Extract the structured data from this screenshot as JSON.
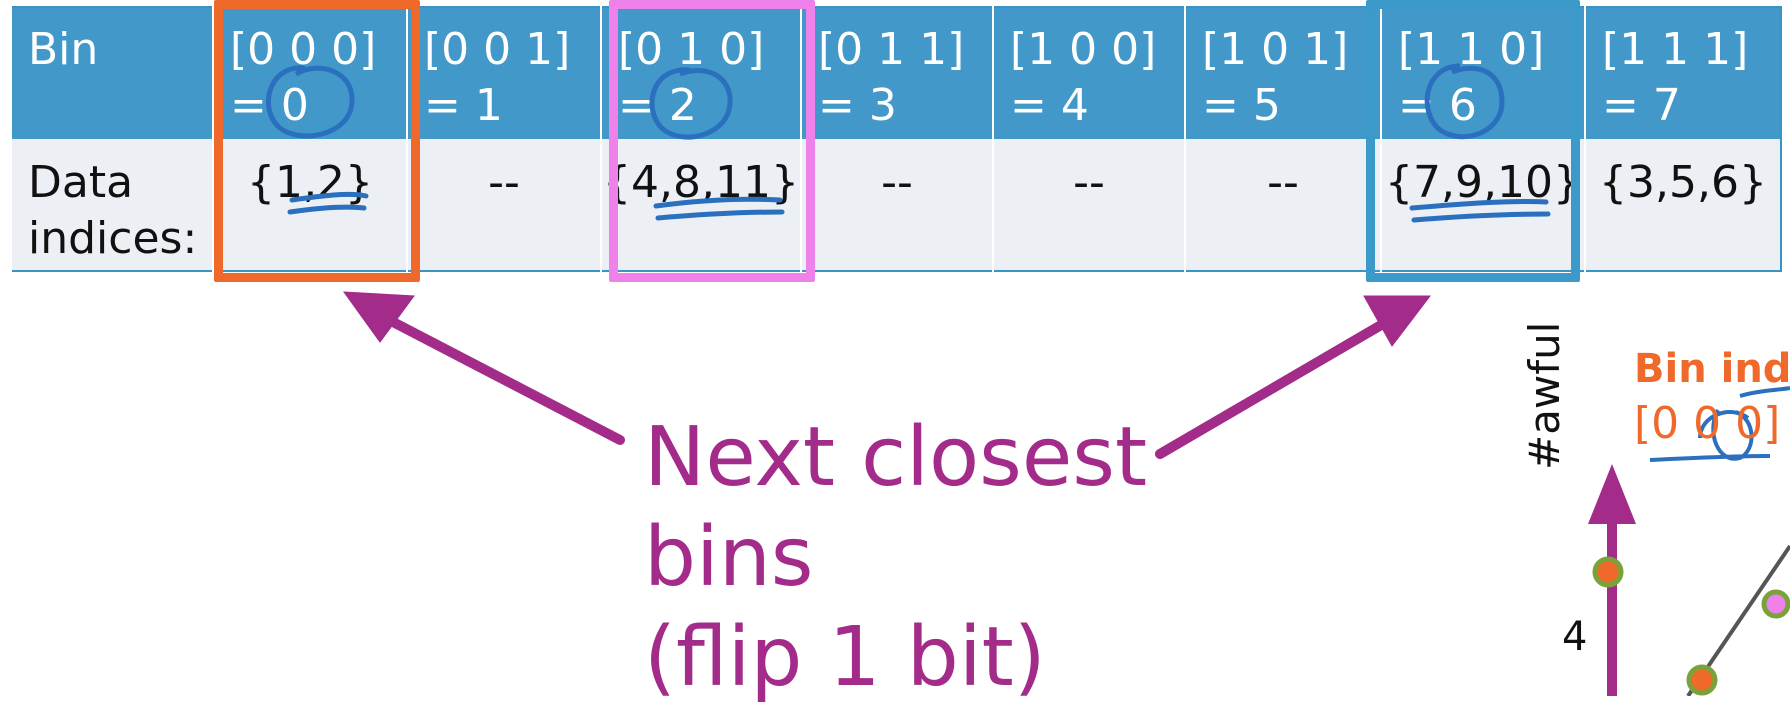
{
  "table": {
    "header_label": "Bin",
    "data_label_line1": "Data",
    "data_label_line2": "indices:",
    "bins": [
      {
        "code": "[0 0 0]",
        "value": "= 0",
        "indices": "{1,2}"
      },
      {
        "code": "[0 0 1]",
        "value": "= 1",
        "indices": "--"
      },
      {
        "code": "[0 1 0]",
        "value": "= 2",
        "indices": "{4,8,11}"
      },
      {
        "code": "[0 1 1]",
        "value": "= 3",
        "indices": "--"
      },
      {
        "code": "[1 0 0]",
        "value": "= 4",
        "indices": "--"
      },
      {
        "code": "[1 0 1]",
        "value": "= 5",
        "indices": "--"
      },
      {
        "code": "[1 1 0]",
        "value": "= 6",
        "indices": "{7,9,10}"
      },
      {
        "code": "[1 1 1]",
        "value": "= 7",
        "indices": "{3,5,6}"
      }
    ]
  },
  "callout": {
    "text": "Next closest\nbins\n(flip 1 bit)"
  },
  "plot": {
    "bin_title": "Bin inde",
    "bin_code": "[0 0 0]",
    "y_label": "#awful",
    "tick_4": "4"
  },
  "colors": {
    "header_bg": "#4298c9",
    "data_bg": "#eceff4",
    "highlight_orange": "#ef6a2a",
    "highlight_pink": "#ee82ea",
    "highlight_blue": "#3b9ac9",
    "arrow_purple": "#a32b8a",
    "ink_blue": "#2b6fbf"
  }
}
